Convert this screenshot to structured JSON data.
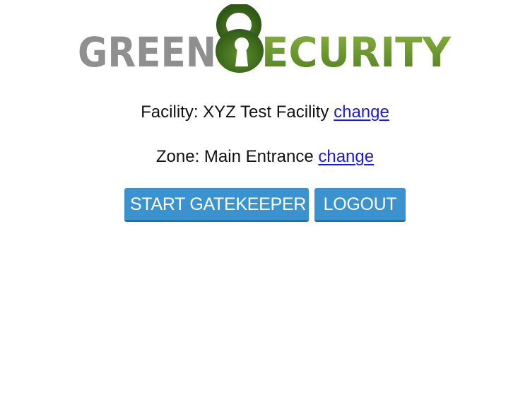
{
  "logo": {
    "word_left": "GREEN",
    "word_right": "ECURITY",
    "colors": {
      "grey": "#8f8f8f",
      "green_light": "#7fa63a",
      "green_dark": "#3e6b1e",
      "keyhole": "#ffffff"
    }
  },
  "facility": {
    "label": "Facility: XYZ Test Facility",
    "link_text": "change"
  },
  "zone": {
    "label": "Zone: Main Entrance",
    "link_text": "change"
  },
  "buttons": {
    "start_label": "START GATEKEEPER",
    "logout_label": "LOGOUT",
    "color": "#3a93cf"
  }
}
